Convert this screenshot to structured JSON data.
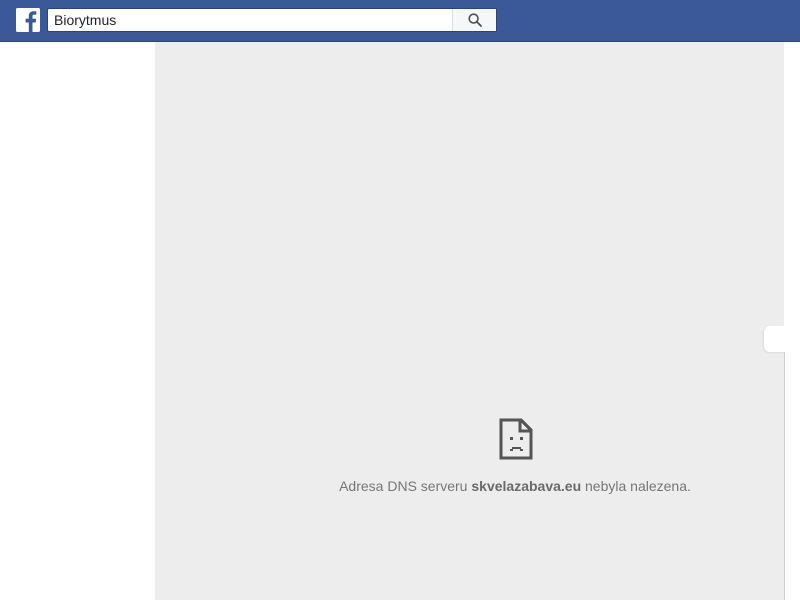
{
  "app": {
    "brand_icon": "facebook-f-icon",
    "brand_color": "#3b5998"
  },
  "search": {
    "value": "Biorytmus",
    "placeholder": "",
    "button_icon": "magnifier-icon"
  },
  "error": {
    "icon": "sad-document-icon",
    "text_before": "Adresa DNS serveru ",
    "domain": "skvelazabava.eu",
    "text_after": " nebyla nalezena."
  },
  "colors": {
    "topbar": "#3b5998",
    "frame_background": "#ededed",
    "error_text": "#777777"
  }
}
